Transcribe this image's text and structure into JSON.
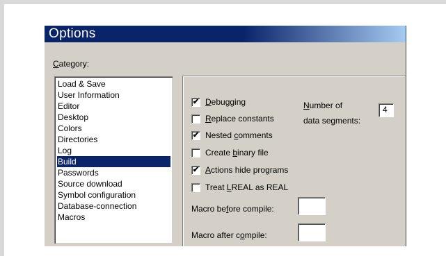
{
  "dialog": {
    "title": "Options"
  },
  "category": {
    "label_pre": "",
    "label_ul": "C",
    "label_post": "ategory:",
    "items": [
      "Load & Save",
      "User Information",
      "Editor",
      "Desktop",
      "Colors",
      "Directories",
      "Log",
      "Build",
      "Passwords",
      "Source download",
      "Symbol configuration",
      "Database-connection",
      "Macros"
    ],
    "selected": "Build"
  },
  "build": {
    "debugging": {
      "pre": "",
      "ul": "D",
      "post": "ebugging",
      "checked": true
    },
    "replace_constants": {
      "pre": "",
      "ul": "R",
      "post": "eplace constants",
      "checked": false
    },
    "nested_comments": {
      "pre": "Nested ",
      "ul": "c",
      "post": "omments",
      "checked": true
    },
    "create_binary": {
      "pre": "Create ",
      "ul": "b",
      "post": "inary file",
      "checked": false
    },
    "actions_hide": {
      "pre": "",
      "ul": "A",
      "post": "ctions hide programs",
      "checked": true
    },
    "treat_lreal": {
      "pre": "Treat ",
      "ul": "L",
      "post": "REAL as REAL",
      "checked": false
    },
    "segments_label_line1_ul": "N",
    "segments_label_line1_post": "umber of",
    "segments_label_line2": "data segments:",
    "segments_value": "4",
    "macro_before": {
      "pre": "Macro be",
      "ul": "f",
      "post": "ore compile:",
      "value": ""
    },
    "macro_after": {
      "pre": "Macro after c",
      "ul": "o",
      "post": "mpile:",
      "value": ""
    }
  },
  "check_mark": "✔"
}
